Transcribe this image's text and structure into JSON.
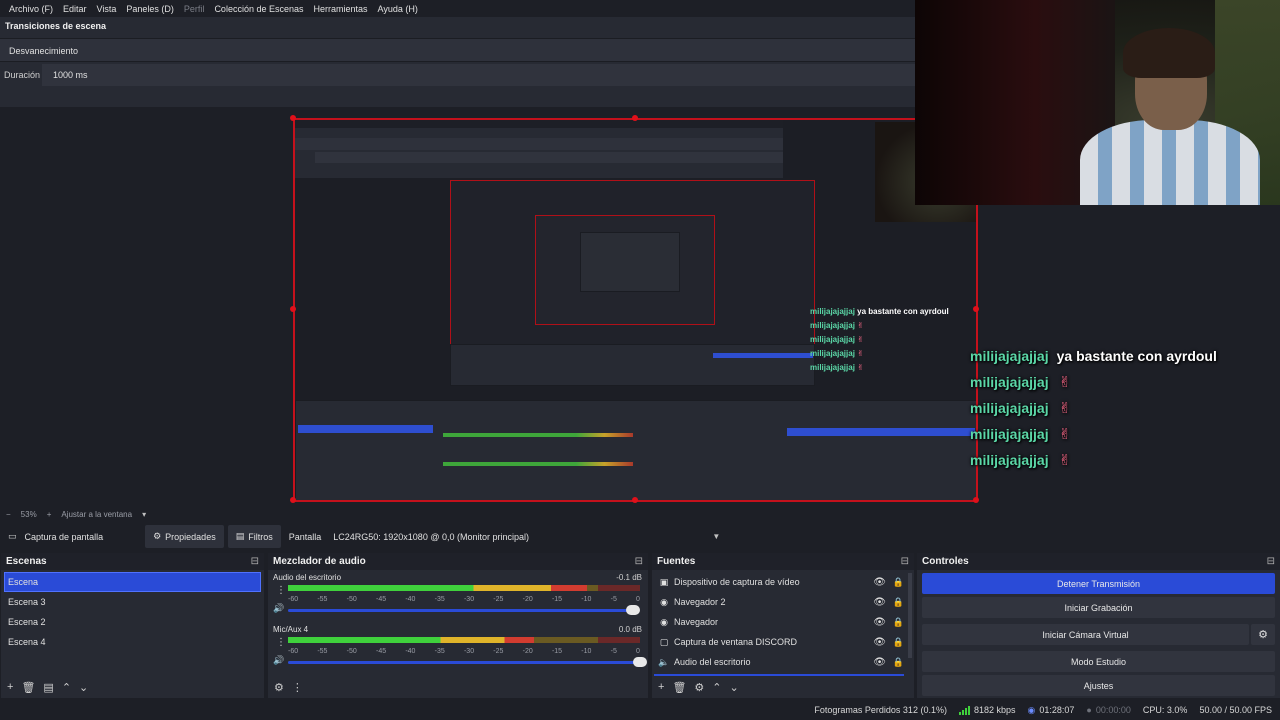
{
  "menu": [
    "Archivo (F)",
    "Editar",
    "Vista",
    "Paneles (D)",
    "Perfil",
    "Colección de Escenas",
    "Herramientas",
    "Ayuda (H)"
  ],
  "transitions": {
    "title": "Transiciones de escena",
    "selected": "Desvanecimiento",
    "duration_label": "Duración",
    "duration_value": "1000 ms"
  },
  "chat": [
    {
      "user": "milijajajajjaj",
      "message": "ya bastante con ayrdoul",
      "emote": ""
    },
    {
      "user": "milijajajajjaj",
      "message": "",
      "emote": "heart-hands-emote"
    },
    {
      "user": "milijajajajjaj",
      "message": "",
      "emote": "heart-hands-emote"
    },
    {
      "user": "milijajajajjaj",
      "message": "",
      "emote": "heart-hands-emote"
    },
    {
      "user": "milijajajajjaj",
      "message": "",
      "emote": "heart-hands-emote"
    }
  ],
  "zoom": {
    "minus": "−",
    "level": "53%",
    "plus": "+",
    "fit_label": "Ajustar a la ventana"
  },
  "source_toolbar": {
    "source_name": "Captura de pantalla",
    "properties": "Propiedades",
    "filters": "Filtros",
    "display_label": "Pantalla",
    "display_value": "LC24RG50: 1920x1080 @ 0,0 (Monitor principal)"
  },
  "scenes": {
    "title": "Escenas",
    "items": [
      "Escena",
      "Escena 3",
      "Escena 2",
      "Escena 4"
    ],
    "active_index": 0
  },
  "mixer": {
    "title": "Mezclador de audio",
    "channels": [
      {
        "name": "Audio del escritorio",
        "db": "-0.1 dB",
        "level": 0.85,
        "volume": 0.98
      },
      {
        "name": "Mic/Aux 4",
        "db": "0.0 dB",
        "level": 0.7,
        "volume": 1.0
      }
    ],
    "scale": [
      "-60",
      "-55",
      "-50",
      "-45",
      "-40",
      "-35",
      "-30",
      "-25",
      "-20",
      "-15",
      "-10",
      "-5",
      "0"
    ]
  },
  "fuentes": {
    "title": "Fuentes",
    "items": [
      {
        "name": "Dispositivo de captura de vídeo",
        "icon": "camera-icon"
      },
      {
        "name": "Navegador 2",
        "icon": "globe-icon"
      },
      {
        "name": "Navegador",
        "icon": "globe-icon"
      },
      {
        "name": "Captura de ventana DISCORD",
        "icon": "window-icon"
      },
      {
        "name": "Audio del escritorio",
        "icon": "speaker-icon"
      }
    ]
  },
  "controles": {
    "title": "Controles",
    "stop_stream": "Detener Transmisión",
    "start_recording": "Iniciar Grabación",
    "start_virtual_cam": "Iniciar Cámara Virtual",
    "studio_mode": "Modo Estudio",
    "settings": "Ajustes"
  },
  "status": {
    "dropped_frames": "Fotogramas Perdidos 312 (0.1%)",
    "bitrate": "8182 kbps",
    "live_time": "01:28:07",
    "rec_time": "00:00:00",
    "cpu": "CPU: 3.0%",
    "fps": "50.00 / 50.00 FPS"
  },
  "colors": {
    "accent": "#2a4bd7",
    "selection_border": "#c4111c",
    "chat_user": "#5bd7a7"
  }
}
